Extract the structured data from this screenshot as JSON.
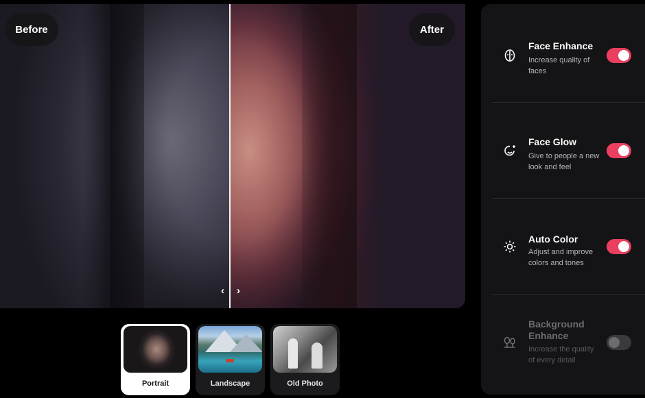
{
  "preview": {
    "before_label": "Before",
    "after_label": "After"
  },
  "thumbnails": [
    {
      "label": "Portrait",
      "active": true
    },
    {
      "label": "Landscape",
      "active": false
    },
    {
      "label": "Old Photo",
      "active": false
    }
  ],
  "settings": [
    {
      "title": "Face Enhance",
      "description": "Increase quality of faces",
      "icon": "face-outline-icon",
      "enabled": true
    },
    {
      "title": "Face Glow",
      "description": "Give to people a new look and feel",
      "icon": "sparkle-smile-icon",
      "enabled": true
    },
    {
      "title": "Auto Color",
      "description": "Adjust and improve colors and tones",
      "icon": "sun-icon",
      "enabled": true
    },
    {
      "title": "Background Enhance",
      "description": "Increase the quality of every detail",
      "icon": "trees-icon",
      "enabled": false
    }
  ],
  "colors": {
    "accent": "#ea3f5e",
    "panel_bg": "#141416",
    "toggle_off": "#3a3a3e"
  }
}
